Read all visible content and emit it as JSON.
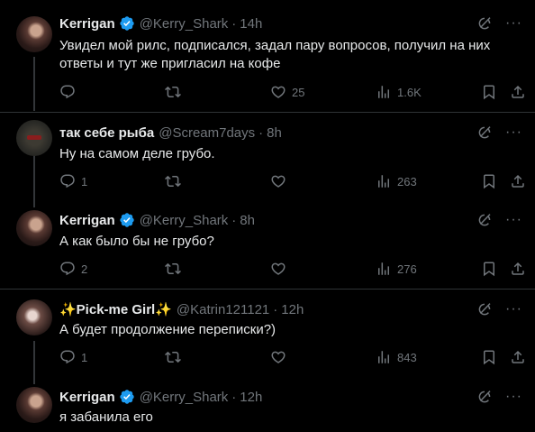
{
  "tweets": [
    {
      "name": "Kerrigan",
      "verified": true,
      "handle": "@Kerry_Shark",
      "time": "14h",
      "text": "Увидел мой рилс, подписался, задал пару вопросов, получил на них ответы и тут же пригласил на кофе",
      "replies": "",
      "retweets": "",
      "likes": "25",
      "views": "1.6K"
    },
    {
      "name": "так себе рыба",
      "verified": false,
      "handle": "@Scream7days",
      "time": "8h",
      "text": "Ну на самом деле грубо.",
      "replies": "1",
      "retweets": "",
      "likes": "",
      "views": "263"
    },
    {
      "name": "Kerrigan",
      "verified": true,
      "handle": "@Kerry_Shark",
      "time": "8h",
      "text": "А как было бы не грубо?",
      "replies": "2",
      "retweets": "",
      "likes": "",
      "views": "276"
    },
    {
      "name": "✨Pick-me Girl✨",
      "verified": false,
      "handle": "@Katrin121121",
      "time": "12h",
      "text": "А будет продолжение переписки?)",
      "replies": "1",
      "retweets": "",
      "likes": "",
      "views": "843"
    },
    {
      "name": "Kerrigan",
      "verified": true,
      "handle": "@Kerry_Shark",
      "time": "12h",
      "text": "я забанила его",
      "replies": "",
      "retweets": "",
      "likes": "",
      "views": ""
    }
  ],
  "dot": "·",
  "more_glyph": "···",
  "colors": {
    "background": "#000000",
    "text": "#e7e9ea",
    "muted": "#71767b",
    "verified": "#1d9bf0",
    "divider": "#2f3336"
  },
  "icons": [
    "reply-icon",
    "retweet-icon",
    "like-icon",
    "views-icon",
    "bookmark-icon",
    "share-icon",
    "grok-icon",
    "more-icon",
    "verified-badge-icon"
  ]
}
